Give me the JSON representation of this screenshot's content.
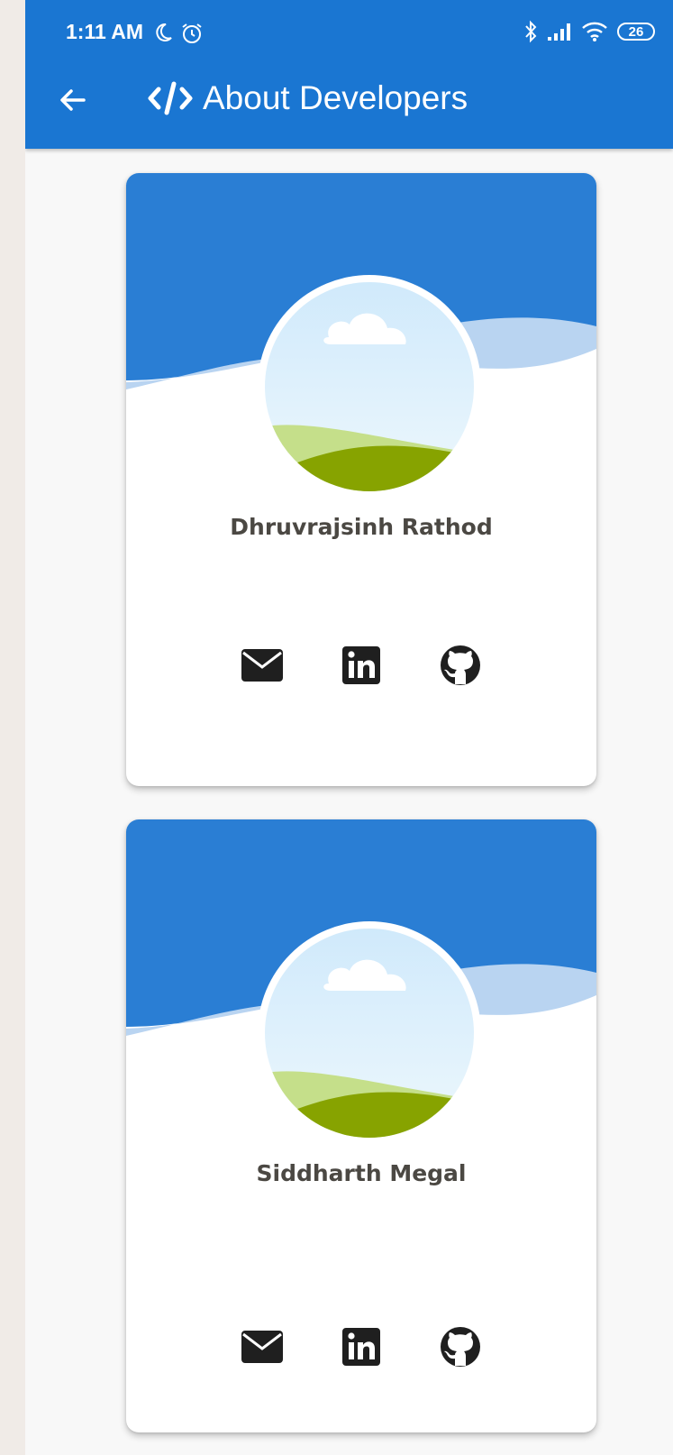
{
  "status_bar": {
    "time": "1:11 AM",
    "battery": "26"
  },
  "app_bar": {
    "title": "About Developers",
    "color": "#1a76d2"
  },
  "developers": [
    {
      "name": "Dhruvrajsinh Rathod",
      "links": [
        "mail-icon",
        "linkedin-icon",
        "github-icon"
      ]
    },
    {
      "name": "Siddharth Megal",
      "links": [
        "mail-icon",
        "linkedin-icon",
        "github-icon"
      ]
    }
  ],
  "colors": {
    "header_blue": "#2a7ed4",
    "wave_light": "#b9d4f1",
    "sky": "#dff1fb",
    "grass_light": "#c5df8a",
    "grass_dark": "#87a300",
    "name_text": "#4b4843"
  }
}
